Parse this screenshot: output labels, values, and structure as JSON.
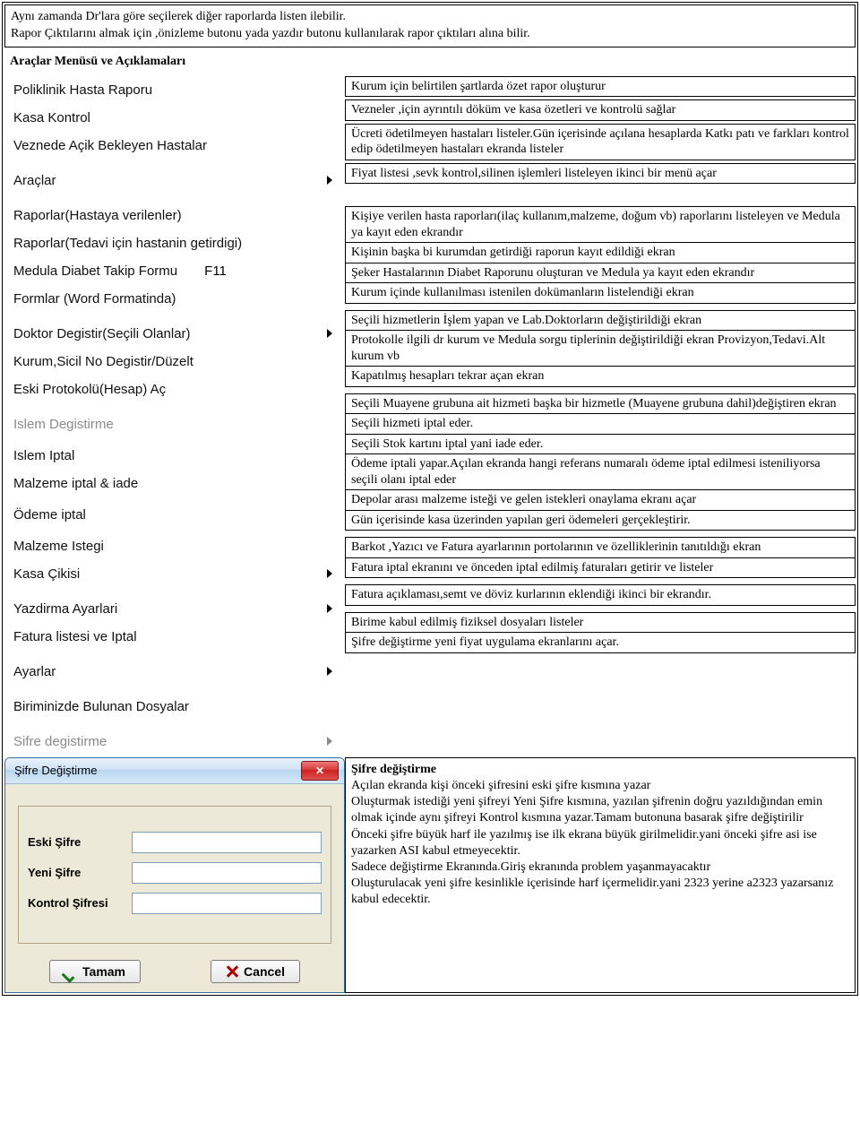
{
  "top_note": {
    "line1": "Aynı zamanda Dr'lara göre seçilerek diğer raporlarda listen ilebilir.",
    "line2": "Rapor Çıktılarını almak için ,önizleme butonu yada yazdır butonu kullanılarak rapor çıktıları alına bilir."
  },
  "section_title": "Araçlar Menüsü ve Açıklamaları",
  "menu": {
    "poliklinik": "Poliklinik Hasta Raporu",
    "kasa": "Kasa Kontrol",
    "vezne": "Veznede Açik Bekleyen Hastalar",
    "araclar": "Araçlar",
    "raporlar_hasta": "Raporlar(Hastaya verilenler)",
    "raporlar_tedavi": "Raporlar(Tedavi için hastanin getirdigi)",
    "medula": "Medula Diabet Takip Formu",
    "medula_key": "F11",
    "formlar": "Formlar (Word Formatinda)",
    "doktor_degistir": "Doktor Degistir(Seçili Olanlar)",
    "kurum_sicil": "Kurum,Sicil No Degistir/Düzelt",
    "eski_protokol": "Eski Protokolü(Hesap) Aç",
    "islem_degistirme": "Islem Degistirme",
    "islem_iptal": "Islem Iptal",
    "malzeme_iptal": "Malzeme iptal & iade",
    "odeme_iptal": "Ödeme iptal",
    "malzeme_istegi": "Malzeme Istegi",
    "kasa_cikisi": "Kasa Çikisi",
    "yazdirma": "Yazdirma Ayarlari",
    "fatura_liste": "Fatura listesi ve Iptal",
    "ayarlar": "Ayarlar",
    "birim_dosya": "Biriminizde Bulunan Dosyalar",
    "sifre_degistirme": "Sifre degistirme"
  },
  "desc": {
    "poliklinik": "Kurum için belirtilen şartlarda özet rapor oluşturur",
    "kasa": "Vezneler ,için  ayrıntılı döküm ve kasa özetleri ve kontrolü sağlar",
    "vezne": "Ücreti ödetilmeyen hastaları listeler.Gün içerisinde açılana hesaplarda Katkı patı ve farkları kontrol edip ödetilmeyen hastaları ekranda listeler",
    "araclar": "Fiyat listesi ,sevk kontrol,silinen işlemleri listeleyen ikinci bir menü açar",
    "raporlar_hasta": "Kişiye verilen hasta raporları(ilaç kullanım,malzeme, doğum vb) raporlarını listeleyen ve Medula ya  kayıt eden ekrandır",
    "raporlar_tedavi": "Kişinin başka bi kurumdan getirdiği raporun kayıt edildiği ekran",
    "medula": "Şeker Hastalarının Diabet Raporunu oluşturan ve Medula ya  kayıt eden ekrandır",
    "formlar": "Kurum içinde kullanılması istenilen dokümanların listelendiği ekran",
    "doktor_degistir": "Seçili hizmetlerin  İşlem yapan ve Lab.Doktorların değiştirildiği ekran",
    "kurum_sicil": "Protokolle ilgili dr kurum ve Medula sorgu tiplerinin değiştirildiği ekran Provizyon,Tedavi.Alt kurum vb",
    "eski_protokol": "Kapatılmış hesapları tekrar açan ekran",
    "islem_degistirme": "Seçili Muayene grubuna ait hizmeti başka bir hizmetle (Muayene grubuna dahil)değiştiren ekran",
    "islem_iptal": "Seçili hizmeti iptal eder.",
    "malzeme_iptal": "Seçili Stok kartını  iptal yani iade eder.",
    "odeme_iptal": "Ödeme iptali yapar.Açılan ekranda hangi referans numaralı ödeme iptal edilmesi isteniliyorsa seçili olanı iptal eder",
    "malzeme_istegi": "Depolar arası malzeme isteği ve gelen istekleri onaylama ekranı açar",
    "kasa_cikisi": "Gün içerisinde kasa üzerinden yapılan geri ödemeleri gerçekleştirir.",
    "yazdirma": "Barkot ,Yazıcı ve Fatura ayarlarının portolarının ve özelliklerinin tanıtıldığı ekran",
    "fatura_liste": "Fatura iptal ekranını ve önceden iptal edilmiş faturaları getirir ve listeler",
    "ayarlar": "Fatura açıklaması,semt ve döviz kurlarının eklendiği ikinci bir ekrandır.",
    "birim_dosya": "Birime kabul edilmiş fiziksel dosyaları listeler",
    "sifre_degistirme": "Şifre değiştirme yeni fiyat uygulama ekranlarını açar."
  },
  "dialog": {
    "title": "Şifre Değiştirme",
    "old": "Eski Şifre",
    "new": "Yeni Şifre",
    "confirm": "Kontrol  Şifresi",
    "ok": "Tamam",
    "cancel": "Cancel"
  },
  "sifre_text": {
    "heading": "Şifre değiştirme",
    "l1": "Açılan ekranda kişi önceki şifresini eski şifre kısmına yazar",
    "l2": "Oluşturmak istediği yeni şifreyi Yeni Şifre kısmına, yazılan şifrenin doğru yazıldığından emin olmak içinde aynı şifreyi Kontrol kısmına yazar.Tamam butonuna basarak şifre değiştirilir",
    "l3": "Önceki şifre büyük harf ile yazılmış ise ilk ekrana büyük girilmelidir.yani önceki şifre asi ise yazarken ASI kabul etmeyecektir.",
    "l4": "Sadece değiştirme Ekranında.Giriş ekranında problem yaşanmayacaktır",
    "l5": "Oluşturulacak yeni şifre kesinlikle içerisinde harf içermelidir.yani 2323  yerine a2323 yazarsanız kabul edecektir."
  }
}
